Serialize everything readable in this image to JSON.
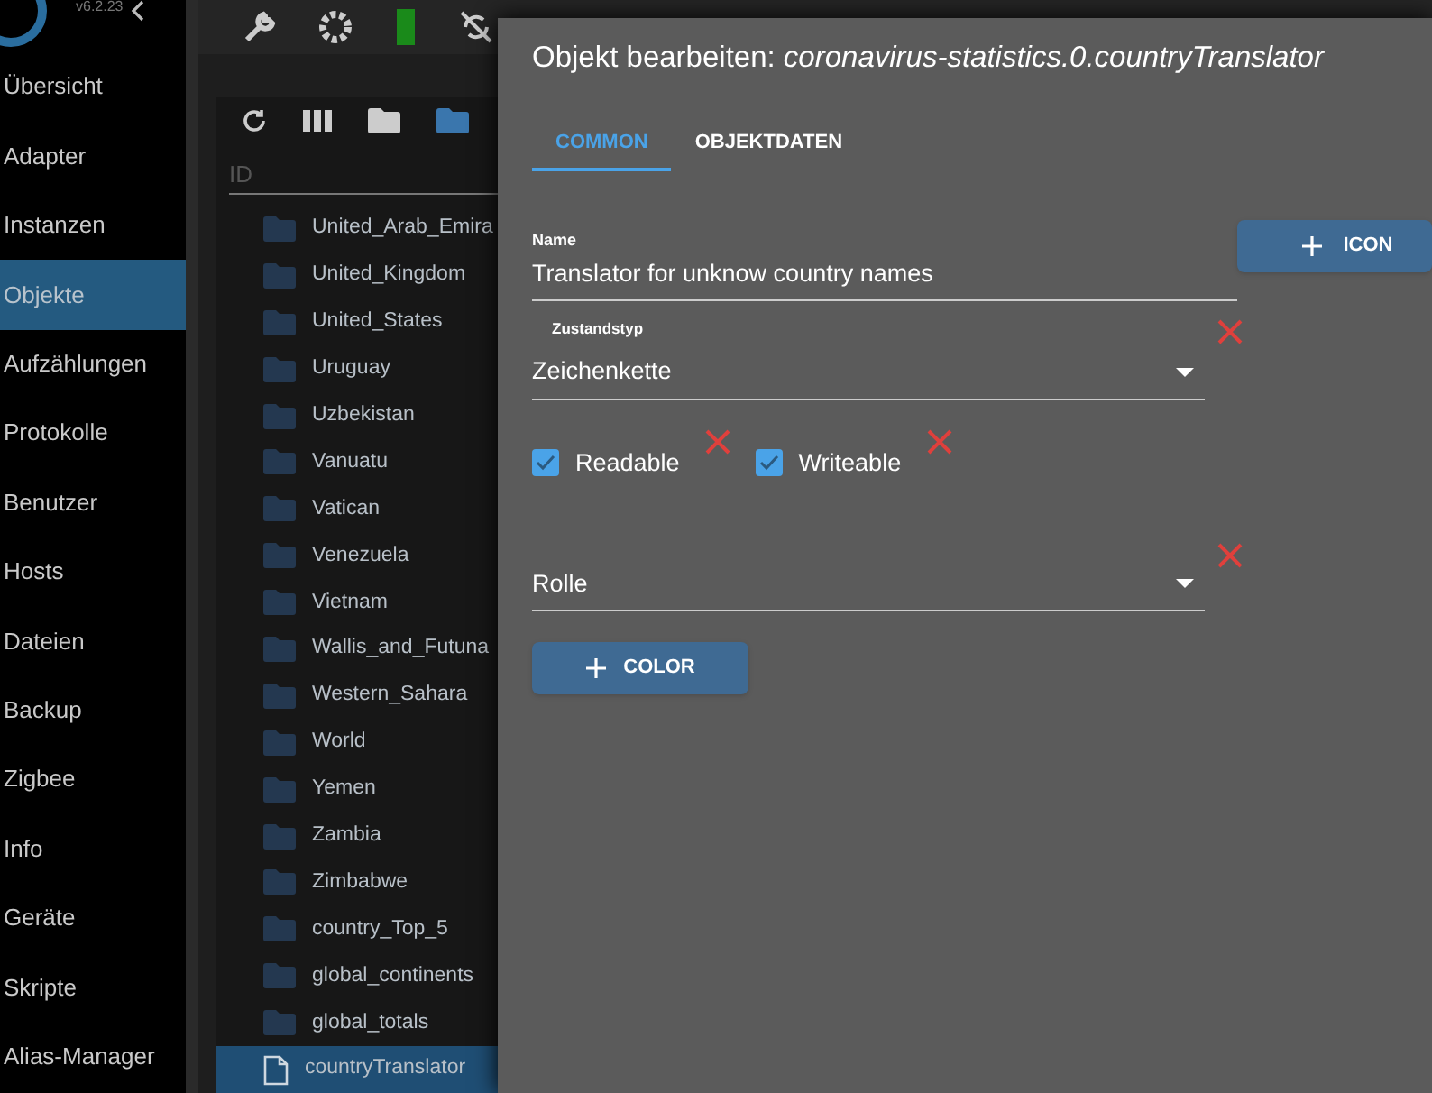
{
  "sidebar": {
    "version": "v6.2.23",
    "items": [
      {
        "label": "Übersicht",
        "selected": false
      },
      {
        "label": "Adapter",
        "selected": false
      },
      {
        "label": "Instanzen",
        "selected": false
      },
      {
        "label": "Objekte",
        "selected": true
      },
      {
        "label": "Aufzählungen",
        "selected": false
      },
      {
        "label": "Protokolle",
        "selected": false
      },
      {
        "label": "Benutzer",
        "selected": false
      },
      {
        "label": "Hosts",
        "selected": false
      },
      {
        "label": "Dateien",
        "selected": false
      },
      {
        "label": "Backup",
        "selected": false
      },
      {
        "label": "Zigbee",
        "selected": false
      },
      {
        "label": "Info",
        "selected": false
      },
      {
        "label": "Geräte",
        "selected": false
      },
      {
        "label": "Skripte",
        "selected": false
      },
      {
        "label": "Alias-Manager",
        "selected": false
      }
    ]
  },
  "tree": {
    "column": "ID",
    "rows": [
      {
        "label": "United_Arab_Emira",
        "kind": "folder",
        "selected": false
      },
      {
        "label": "United_Kingdom",
        "kind": "folder",
        "selected": false
      },
      {
        "label": "United_States",
        "kind": "folder",
        "selected": false
      },
      {
        "label": "Uruguay",
        "kind": "folder",
        "selected": false
      },
      {
        "label": "Uzbekistan",
        "kind": "folder",
        "selected": false
      },
      {
        "label": "Vanuatu",
        "kind": "folder",
        "selected": false
      },
      {
        "label": "Vatican",
        "kind": "folder",
        "selected": false
      },
      {
        "label": "Venezuela",
        "kind": "folder",
        "selected": false
      },
      {
        "label": "Vietnam",
        "kind": "folder",
        "selected": false
      },
      {
        "label": "Wallis_and_Futuna",
        "kind": "folder",
        "selected": false
      },
      {
        "label": "Western_Sahara",
        "kind": "folder",
        "selected": false
      },
      {
        "label": "World",
        "kind": "folder",
        "selected": false
      },
      {
        "label": "Yemen",
        "kind": "folder",
        "selected": false
      },
      {
        "label": "Zambia",
        "kind": "folder",
        "selected": false
      },
      {
        "label": "Zimbabwe",
        "kind": "folder",
        "selected": false
      },
      {
        "label": "country_Top_5",
        "kind": "folder",
        "selected": false
      },
      {
        "label": "global_continents",
        "kind": "folder",
        "selected": false
      },
      {
        "label": "global_totals",
        "kind": "folder",
        "selected": false
      },
      {
        "label": "countryTranslator",
        "kind": "file",
        "selected": true
      }
    ]
  },
  "dialog": {
    "title": "Objekt bearbeiten: ",
    "title_object": "coronavirus-statistics.0.countryTranslator",
    "tabs": [
      {
        "label": "COMMON",
        "selected": true
      },
      {
        "label": "OBJEKTDATEN",
        "selected": false
      }
    ],
    "name": {
      "label": "Name",
      "value": "Translator for unknow country names"
    },
    "icon_button": "ICON",
    "state_type": {
      "label": "Zustandstyp",
      "value": "Zeichenkette"
    },
    "checkboxes": [
      {
        "label": "Readable",
        "checked": true
      },
      {
        "label": "Writeable",
        "checked": true
      }
    ],
    "role": {
      "placeholder": "Rolle"
    },
    "color_button": "COLOR"
  }
}
